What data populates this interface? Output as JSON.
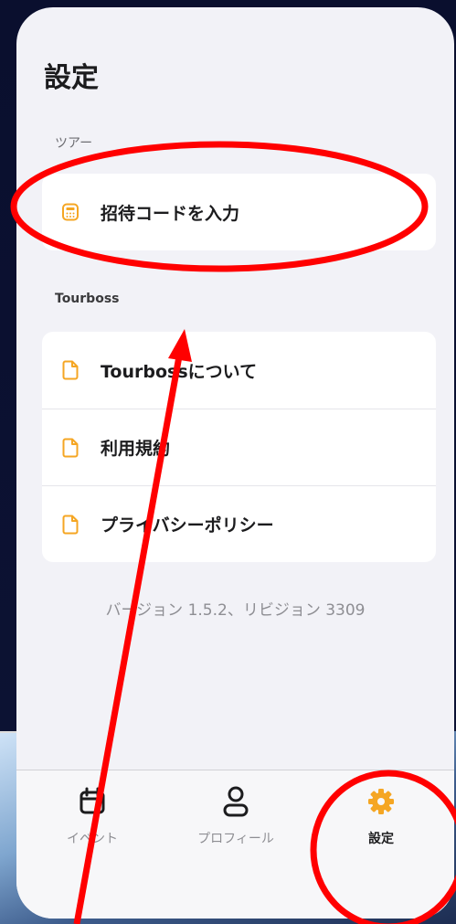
{
  "page": {
    "title": "設定"
  },
  "sections": [
    {
      "label": "ツアー",
      "items": [
        {
          "label": "招待コードを入力",
          "icon": "calculator-icon"
        }
      ]
    },
    {
      "label": "Tourboss",
      "items": [
        {
          "label": "Tourbossについて",
          "icon": "document-icon"
        },
        {
          "label": "利用規約",
          "icon": "document-icon"
        },
        {
          "label": "プライバシーポリシー",
          "icon": "document-icon"
        }
      ]
    }
  ],
  "version_text": "バージョン 1.5.2、リビジョン 3309",
  "tabbar": {
    "tabs": [
      {
        "label": "イベント",
        "icon": "calendar-icon",
        "active": false
      },
      {
        "label": "プロフィール",
        "icon": "person-icon",
        "active": false
      },
      {
        "label": "設定",
        "icon": "gear-icon",
        "active": true
      }
    ]
  },
  "colors": {
    "accent": "#f5a623",
    "annotation": "#ff0000",
    "background": "#f2f2f7"
  }
}
